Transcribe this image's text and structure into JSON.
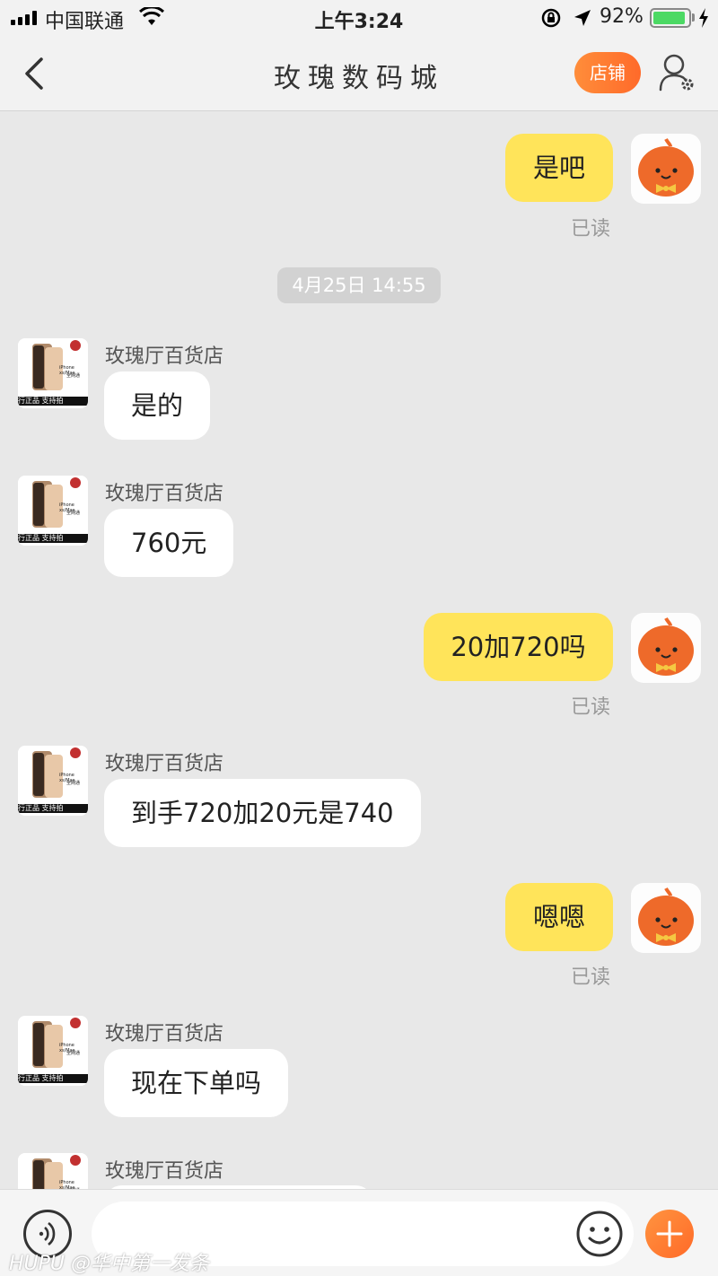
{
  "status_bar": {
    "carrier": "中国联通",
    "time": "上午3:24",
    "battery_percent": "92%",
    "battery_level": 0.92
  },
  "header": {
    "title": "玫瑰数码城",
    "store_button": "店铺",
    "back_icon": "chevron-left-icon",
    "settings_icon": "user-settings-icon"
  },
  "messages": [
    {
      "from": "me",
      "text": "是吧",
      "status": "已读"
    },
    {
      "type": "timestamp",
      "text": "4月25日 14:55"
    },
    {
      "from": "shop",
      "sender": "玫瑰厅百货店",
      "text": "是的"
    },
    {
      "from": "shop",
      "sender": "玫瑰厅百货店",
      "text": "760元"
    },
    {
      "from": "me",
      "text": "20加720吗",
      "status": "已读"
    },
    {
      "from": "shop",
      "sender": "玫瑰厅百货店",
      "text": "到手720加20元是740"
    },
    {
      "from": "me",
      "text": "嗯嗯",
      "status": "已读"
    },
    {
      "from": "shop",
      "sender": "玫瑰厅百货店",
      "text": "现在下单吗"
    },
    {
      "from": "shop",
      "sender": "玫瑰厅百货店",
      "text": ""
    }
  ],
  "shop_avatar": {
    "product_text": "iPhone xs/Max",
    "network_text": "全网通",
    "banner": "行正品 支持拍"
  },
  "input": {
    "placeholder": "",
    "voice_icon": "voice-icon",
    "emoji_icon": "emoji-icon",
    "plus_icon": "plus-icon"
  },
  "watermark": "HUPU @华中第一发条",
  "colors": {
    "accent": "#ff7a30",
    "my_bubble": "#ffe45a",
    "shop_bubble": "#ffffff",
    "background": "#e8e8e8"
  }
}
